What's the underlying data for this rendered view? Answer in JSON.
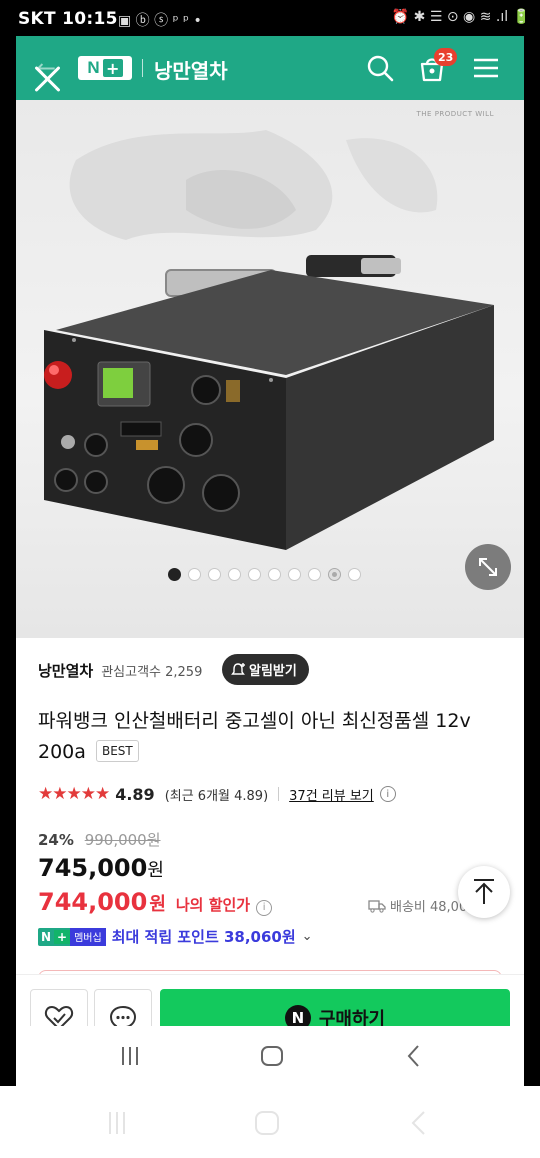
{
  "status_bar": {
    "carrier_time": "SKT 10:15",
    "left_icons": "▣ ⓑ ⓢ ᵖ ᵖ •",
    "right_icons": "⏰ ✱ ☰ ⊙ ◉ ≋ .ıl 🔋"
  },
  "header": {
    "brand_n": "N",
    "brand_plus": "+",
    "store_title": "낭만열차",
    "cart_count": "23"
  },
  "hero": {
    "watermark": "THE PRODUCT WILL",
    "image_dots": 10,
    "active_dot": 0
  },
  "store": {
    "name": "낭만열차",
    "followers": "관심고객수 2,259",
    "alarm_label": "알림받기"
  },
  "product": {
    "title": "파워뱅크 인산철배터리 중고셀이 아닌 최신정품셀 12v 200a",
    "badge": "BEST",
    "stars": "★★★★★",
    "rating": "4.89",
    "recent_rating": "(최근 6개월 4.89)",
    "reviews_link": "37건 리뷰 보기",
    "discount_rate": "24%",
    "original_price": "990,000원",
    "price": "745,000",
    "price_unit": "원",
    "sale_price": "744,000",
    "sale_unit": "원",
    "my_discount": "나의 할인가",
    "shipping": "배송비 48,000원",
    "member_badge_text": "멤버십",
    "points": "최대 적립 포인트 38,060원"
  },
  "actions": {
    "buy_logo": "N",
    "buy_label": "구매하기"
  },
  "colors": {
    "brand_green": "#1fa886",
    "buy_green": "#13c95d",
    "sale_red": "#e8323e",
    "points_blue": "#3b3bdc"
  }
}
